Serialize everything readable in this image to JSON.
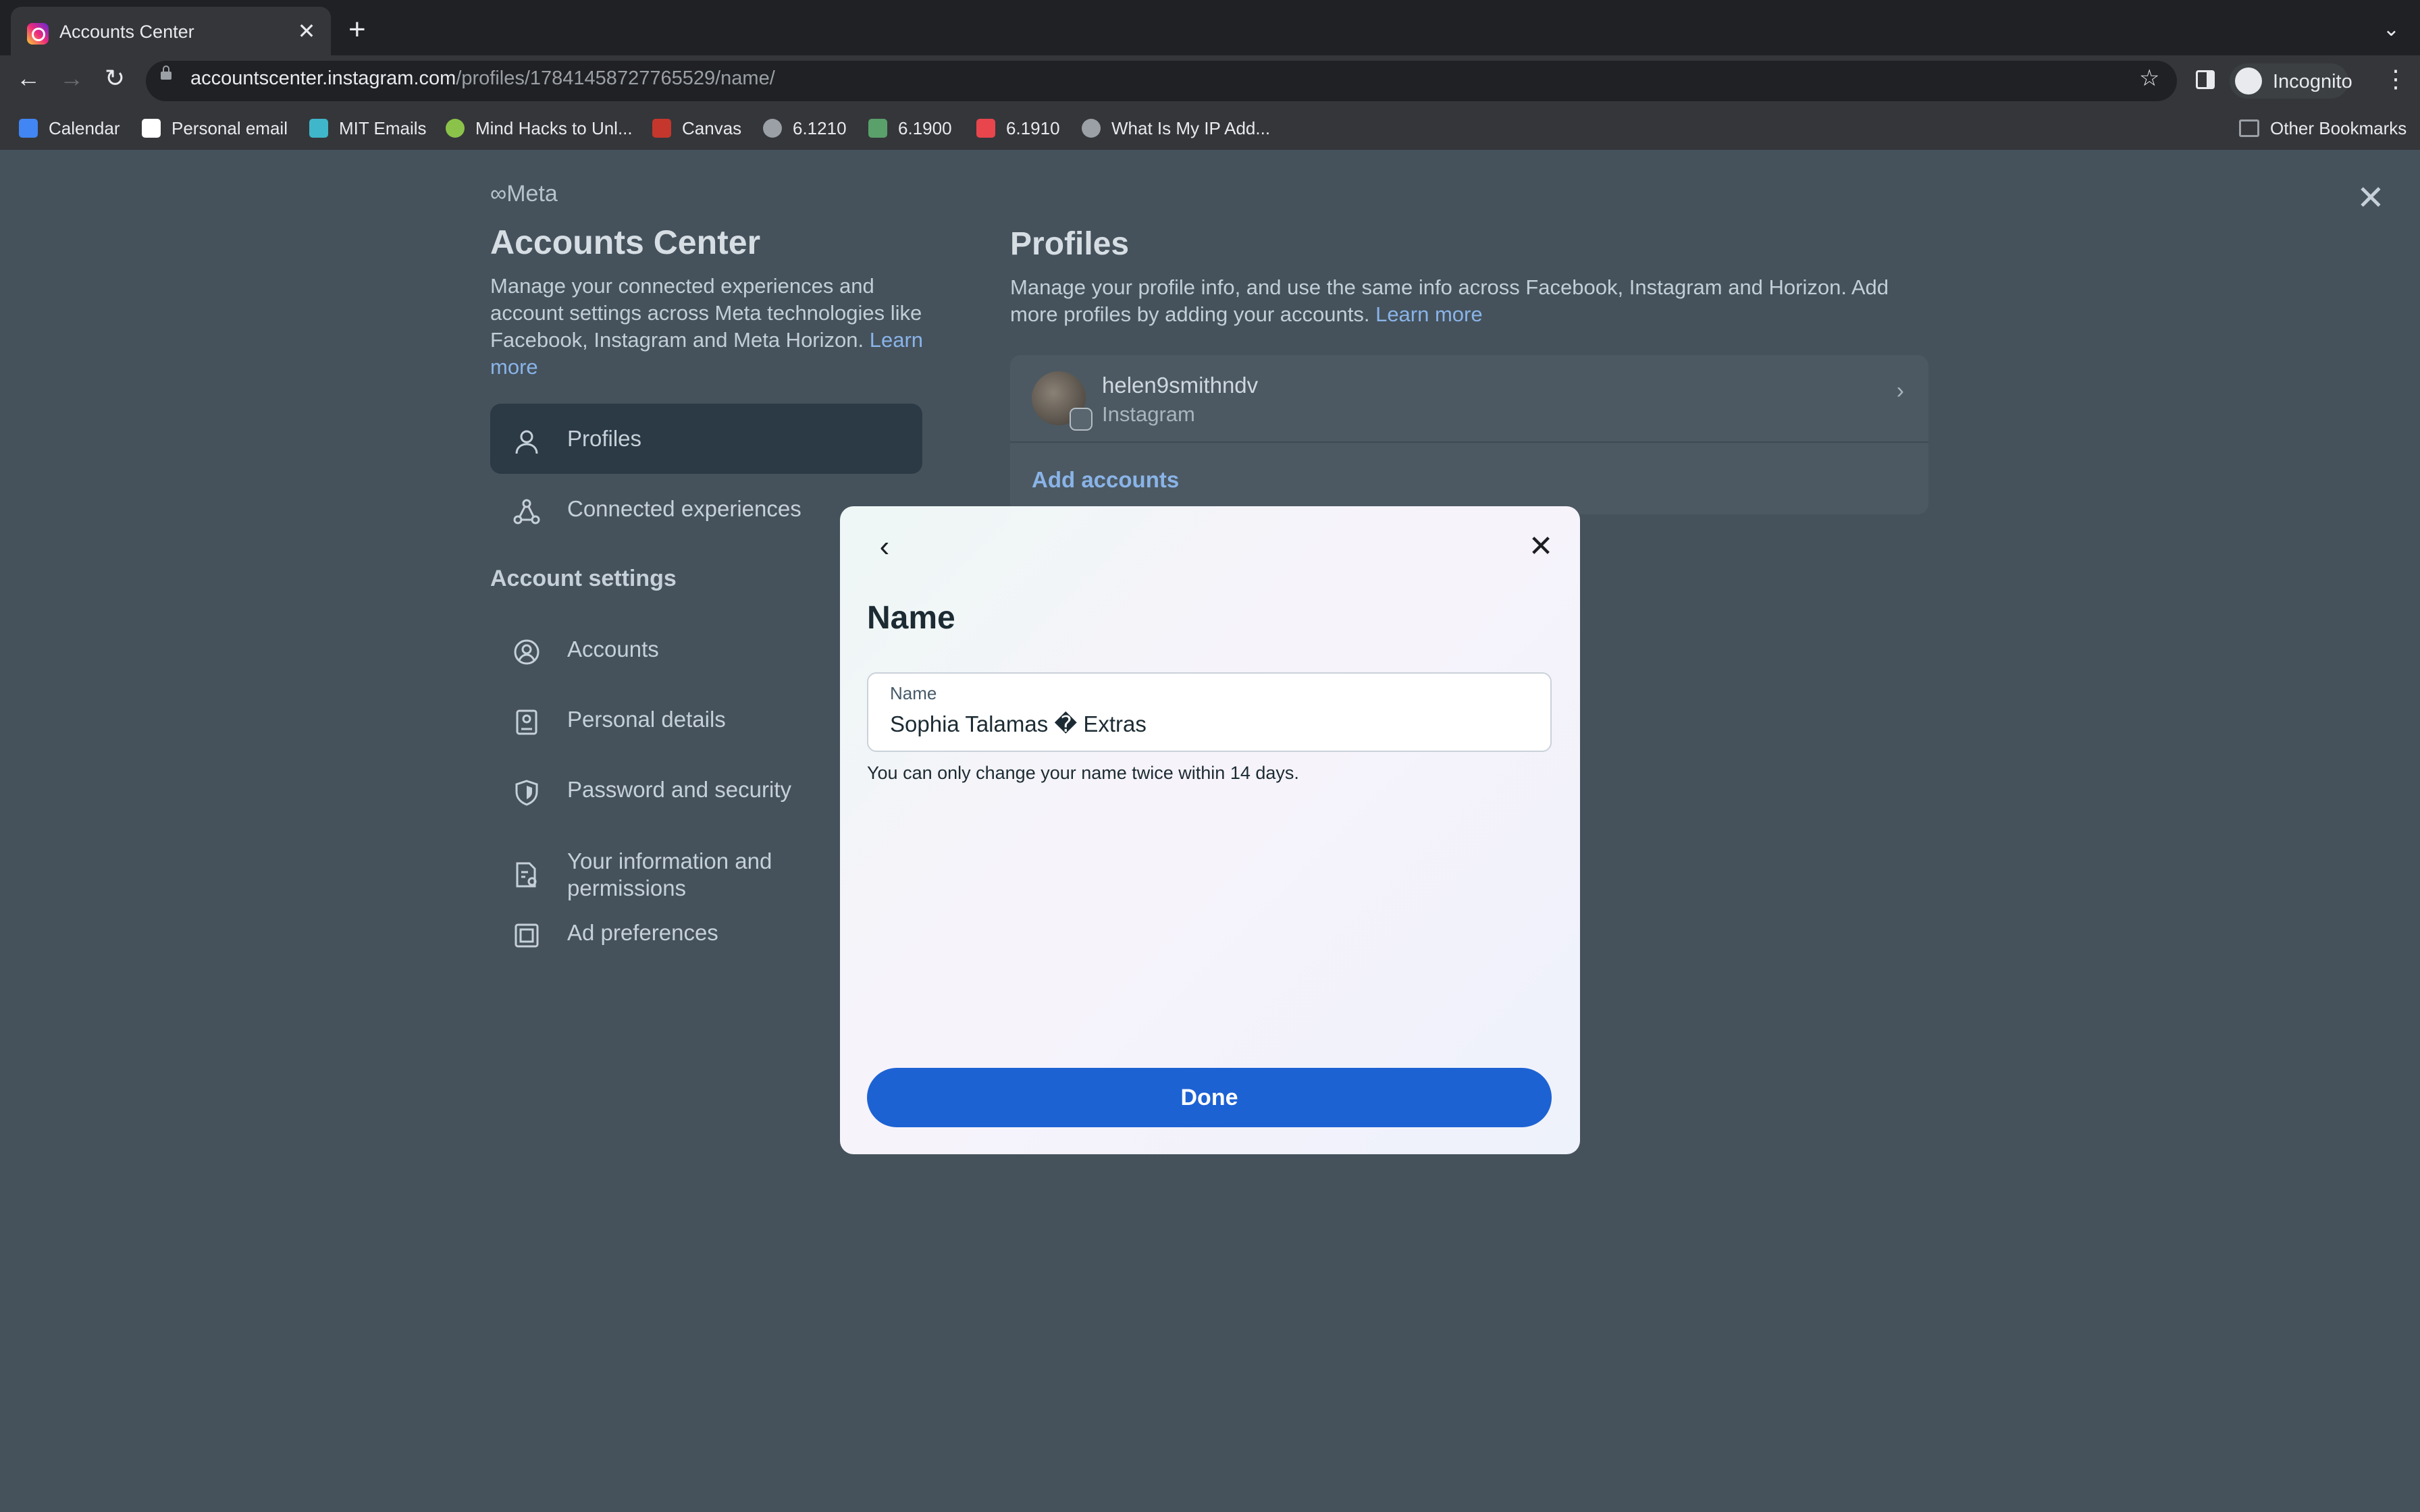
{
  "browser": {
    "tab_title": "Accounts Center",
    "tab_close": "✕",
    "new_tab": "+",
    "tab_menu": "⌄",
    "nav": {
      "back": "←",
      "forward": "→",
      "reload": "↻"
    },
    "url_host": "accountscenter.instagram.com",
    "url_path": "/profiles/17841458727765529/name/",
    "star": "☆",
    "profile_label": "Incognito",
    "menu": "⋮",
    "bookmarks": [
      {
        "label": "Calendar",
        "icon": "calendar-icon",
        "color": "#4285f4"
      },
      {
        "label": "Personal email",
        "icon": "email-icon",
        "color": "#ffffff"
      },
      {
        "label": "MIT Emails",
        "icon": "mit-email-icon",
        "color": "#3fb6c9"
      },
      {
        "label": "Mind Hacks to Unl...",
        "icon": "play-icon",
        "color": "#8bc34a"
      },
      {
        "label": "Canvas",
        "icon": "canvas-icon",
        "color": "#c5372c"
      },
      {
        "label": "6.1210",
        "icon": "globe-icon",
        "color": "#9aa0a6"
      },
      {
        "label": "6.1900",
        "icon": "course-icon",
        "color": "#5aa06b"
      },
      {
        "label": "6.1910",
        "icon": "course-icon",
        "color": "#e8454d"
      },
      {
        "label": "What Is My IP Add...",
        "icon": "globe-icon",
        "color": "#9aa0a6"
      }
    ],
    "other_bookmarks": "Other Bookmarks"
  },
  "page": {
    "meta_logo": "∞Meta",
    "title": "Accounts Center",
    "description": "Manage your connected experiences and account settings across Meta technologies like Facebook, Instagram and Meta Horizon.",
    "learn_more": "Learn more",
    "nav": {
      "profiles": "Profiles",
      "connected": "Connected experiences",
      "section": "Account settings",
      "accounts": "Accounts",
      "personal": "Personal details",
      "password": "Password and security",
      "info_line1": "Your information and",
      "info_line2": "permissions",
      "ads": "Ad preferences"
    },
    "close": "✕",
    "profiles_title": "Profiles",
    "profiles_desc": "Manage your profile info, and use the same info across Facebook, Instagram and Horizon. Add more profiles by adding your accounts.",
    "profiles_learn_more": "Learn more",
    "profile": {
      "username": "helen9smithndv",
      "platform": "Instagram",
      "chevron": "›"
    },
    "add_accounts": "Add accounts"
  },
  "modal": {
    "back": "‹",
    "close": "✕",
    "title": "Name",
    "field_label": "Name",
    "field_value": "Sophia Talamas � Extras",
    "hint": "You can only change your name twice within 14 days.",
    "done": "Done"
  }
}
